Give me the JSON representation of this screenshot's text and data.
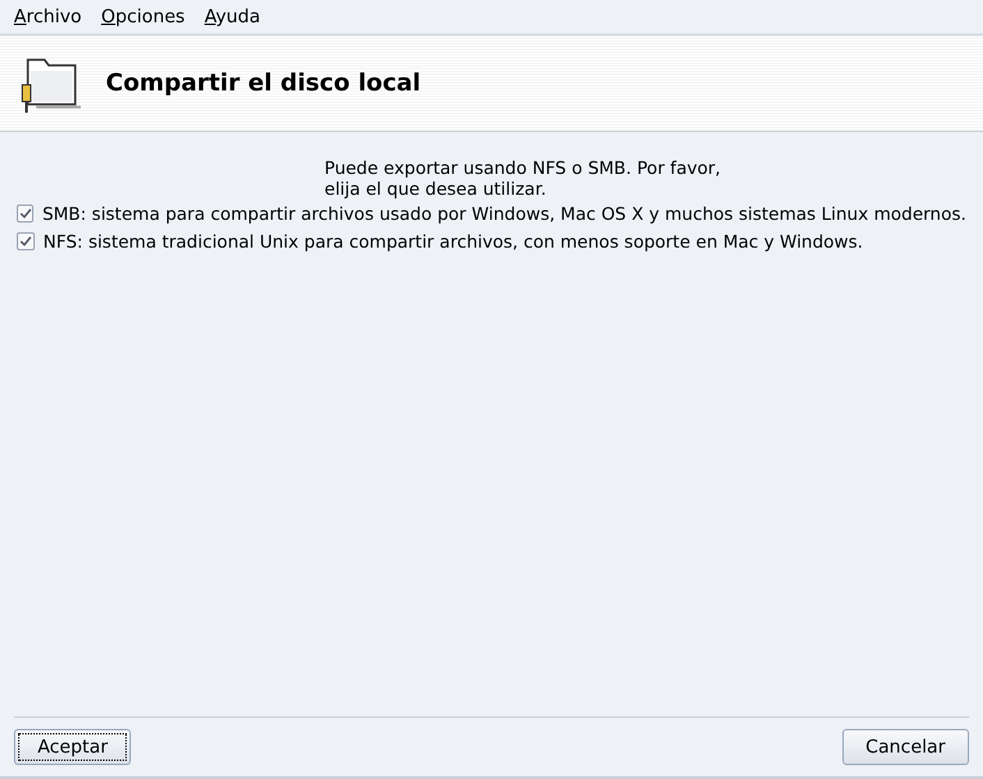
{
  "menu": [
    "Archivo",
    "Opciones",
    "Ayuda"
  ],
  "header": {
    "title": "Compartir el disco local"
  },
  "intro": [
    "Puede exportar usando NFS o SMB. Por favor,",
    "elija el que desea utilizar."
  ],
  "options": [
    {
      "label": "SMB: sistema para compartir archivos usado por Windows, Mac OS X y muchos sistemas Linux modernos.",
      "checked": true
    },
    {
      "label": "NFS: sistema tradicional Unix para compartir archivos, con menos soporte en Mac y Windows.",
      "checked": true
    }
  ],
  "buttons": [
    {
      "label": "Aceptar",
      "focused": true
    },
    {
      "label": "Cancelar",
      "focused": false
    }
  ]
}
